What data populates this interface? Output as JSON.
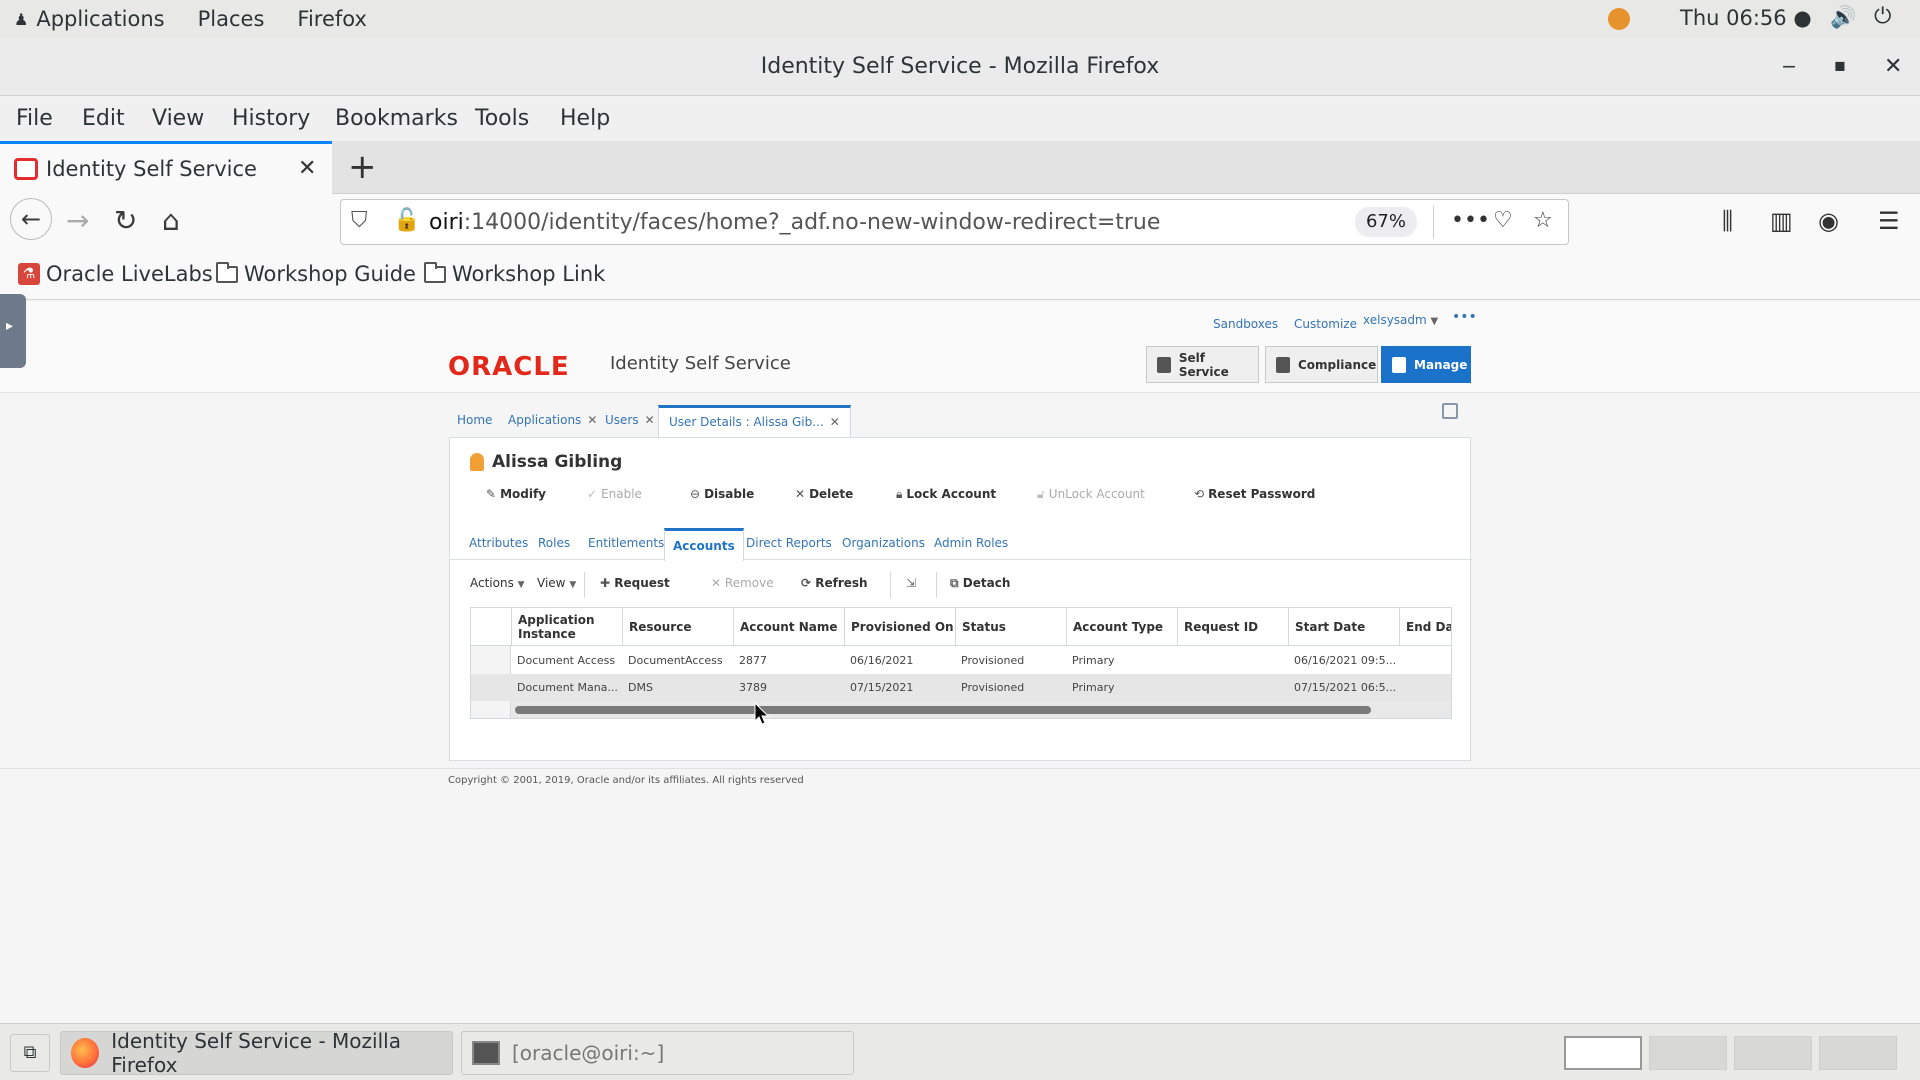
{
  "desktop": {
    "menu": [
      "Applications",
      "Places",
      "Firefox"
    ],
    "clock": "Thu 06:56 ●"
  },
  "window": {
    "title": "Identity Self Service - Mozilla Firefox",
    "menu": [
      "File",
      "Edit",
      "View",
      "History",
      "Bookmarks",
      "Tools",
      "Help"
    ]
  },
  "tab": {
    "title": "Identity Self Service"
  },
  "urlbar": {
    "host": "oiri",
    "path": ":14000/identity/faces/home?_adf.no-new-window-redirect=true",
    "zoom": "67%"
  },
  "bookmarks": [
    "Oracle LiveLabs",
    "Workshop Guide",
    "Workshop Link"
  ],
  "app": {
    "toplinks": [
      "Sandboxes",
      "Customize",
      "xelsysadm"
    ],
    "logo": "ORACLE",
    "name": "Identity Self Service",
    "header_buttons": [
      "Self Service",
      "Compliance",
      "Manage"
    ],
    "page_tabs": [
      "Home",
      "Applications",
      "Users",
      "User Details : Alissa Gib..."
    ],
    "user_name": "Alissa Gibling",
    "actions": [
      "Modify",
      "Enable",
      "Disable",
      "Delete",
      "Lock Account",
      "UnLock Account",
      "Reset Password"
    ],
    "sub_tabs": [
      "Attributes",
      "Roles",
      "Entitlements",
      "Accounts",
      "Direct Reports",
      "Organizations",
      "Admin Roles"
    ],
    "toolbar": [
      "Actions",
      "View",
      "Request",
      "Remove",
      "Refresh",
      "Detach"
    ],
    "table": {
      "columns": [
        "Application\nInstance",
        "Resource",
        "Account Name",
        "Provisioned On",
        "Status",
        "Account Type",
        "Request ID",
        "Start Date",
        "End Da"
      ],
      "rows": [
        [
          "Document Access",
          "DocumentAccess",
          "2877",
          "06/16/2021",
          "Provisioned",
          "Primary",
          "",
          "06/16/2021 09:5...",
          ""
        ],
        [
          "Document Mana...",
          "DMS",
          "3789",
          "07/15/2021",
          "Provisioned",
          "Primary",
          "",
          "07/15/2021 06:5...",
          ""
        ]
      ]
    },
    "copyright": "Copyright © 2001, 2019, Oracle and/or its affiliates. All rights reserved"
  },
  "taskbar": {
    "items": [
      "Identity Self Service - Mozilla Firefox",
      "[oracle@oiri:~]"
    ]
  }
}
